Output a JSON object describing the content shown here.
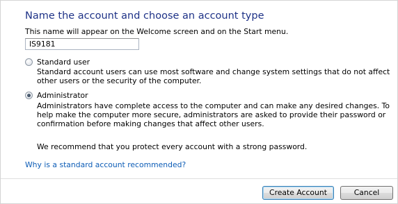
{
  "title": "Name the account and choose an account type",
  "intro": "This name will appear on the Welcome screen and on the Start menu.",
  "account_name": {
    "value": "IS9181"
  },
  "options": {
    "standard": {
      "label": "Standard user",
      "description": "Standard account users can use most software and change system settings that do not affect other users or the security of the computer.",
      "checked": false
    },
    "administrator": {
      "label": "Administrator",
      "description": "Administrators have complete access to the computer and can make any desired changes. To help make the computer more secure, administrators are asked to provide their password or confirmation before making changes that affect other users.",
      "checked": true
    }
  },
  "recommendation": "We recommend that you protect every account with a strong password.",
  "help_link": "Why is a standard account recommended?",
  "buttons": {
    "create": "Create Account",
    "cancel": "Cancel"
  },
  "colors": {
    "title": "#1e3287",
    "link": "#0c5cb6"
  }
}
